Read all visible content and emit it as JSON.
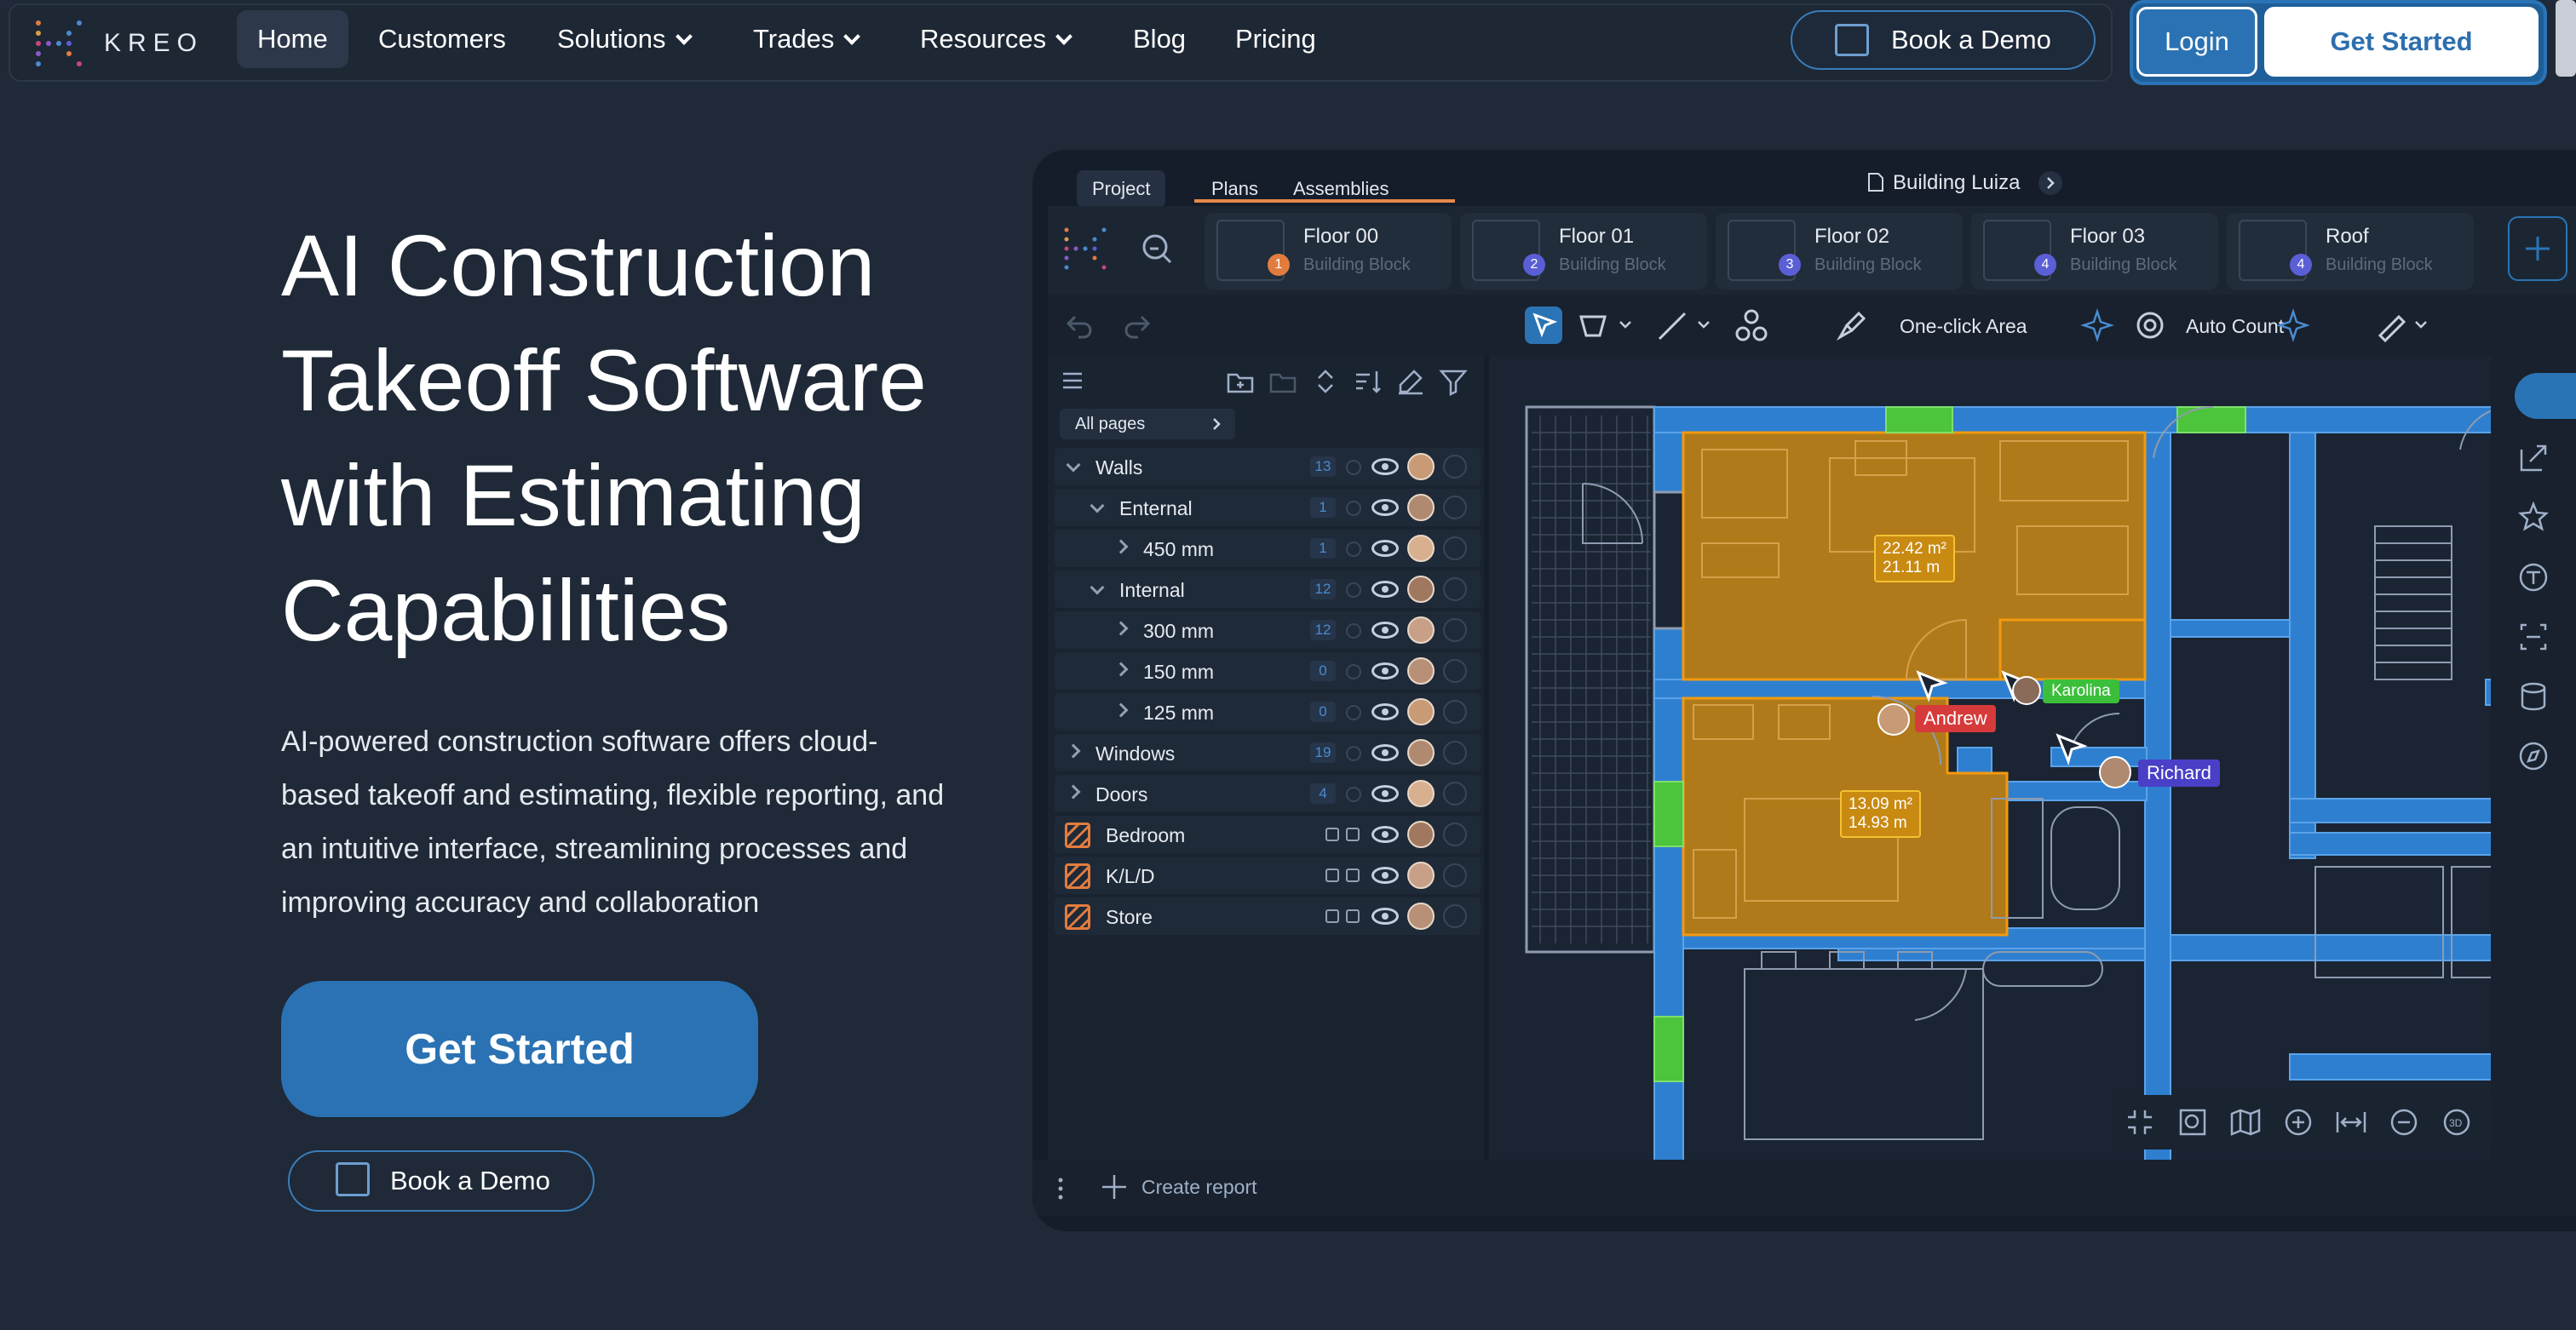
{
  "nav": {
    "brand": "KREO",
    "links": [
      {
        "label": "Home",
        "active": true
      },
      {
        "label": "Customers"
      },
      {
        "label": "Solutions",
        "dropdown": true
      },
      {
        "label": "Trades",
        "dropdown": true
      },
      {
        "label": "Resources",
        "dropdown": true
      },
      {
        "label": "Blog"
      },
      {
        "label": "Pricing"
      }
    ],
    "book_demo": "Book a Demo",
    "login": "Login",
    "get_started": "Get Started"
  },
  "hero": {
    "title_lines": [
      "AI Construction",
      "Takeoff Software",
      "with Estimating",
      "Capabilities"
    ],
    "desc_lines": [
      "AI-powered construction software offers cloud-",
      "based takeoff and estimating, flexible reporting, and",
      "an intuitive interface, streamlining processes and",
      "improving accuracy and collaboration"
    ],
    "cta": "Get Started",
    "demo": "Book a Demo"
  },
  "app": {
    "tabs": [
      "Project",
      "Plans",
      "Assemblies"
    ],
    "project_name": "Building Luiza",
    "floors": [
      {
        "name": "Floor 00",
        "sub": "Building Block",
        "badge": "1",
        "badge_color": "#e27c3e"
      },
      {
        "name": "Floor 01",
        "sub": "Building Block",
        "badge": "2",
        "badge_color": "#5a5fd6"
      },
      {
        "name": "Floor 02",
        "sub": "Building Block",
        "badge": "3",
        "badge_color": "#5a5fd6"
      },
      {
        "name": "Floor 03",
        "sub": "Building Block",
        "badge": "4",
        "badge_color": "#5a5fd6"
      },
      {
        "name": "Roof",
        "sub": "Building Block",
        "badge": "4",
        "badge_color": "#5a5fd6"
      }
    ],
    "tools": {
      "one_click": "One-click Area",
      "auto_count": "Auto Count"
    },
    "all_pages": "All pages",
    "tree": [
      {
        "label": "Walls",
        "count": "13",
        "level": 0,
        "open": true
      },
      {
        "label": "Enternal",
        "count": "1",
        "level": 1,
        "open": true
      },
      {
        "label": "450 mm",
        "count": "1",
        "level": 2,
        "open": false
      },
      {
        "label": "Internal",
        "count": "12",
        "level": 1,
        "open": true
      },
      {
        "label": "300 mm",
        "count": "12",
        "level": 2,
        "open": false
      },
      {
        "label": "150 mm",
        "count": "0",
        "level": 2,
        "open": false
      },
      {
        "label": "125 mm",
        "count": "0",
        "level": 2,
        "open": false
      },
      {
        "label": "Windows",
        "count": "19",
        "level": 0,
        "open": false
      },
      {
        "label": "Doors",
        "count": "4",
        "level": 0,
        "open": false
      },
      {
        "label": "Bedroom",
        "area": true
      },
      {
        "label": "K/L/D",
        "area": true
      },
      {
        "label": "Store",
        "area": true
      }
    ],
    "create_report": "Create report",
    "areas": [
      {
        "area": "22.42 m²",
        "perimeter": "21.11 m"
      },
      {
        "area": "13.09 m²",
        "perimeter": "14.93 m"
      }
    ],
    "collaborators": [
      {
        "name": "Andrew",
        "color": "#d63a3a"
      },
      {
        "name": "Karolina",
        "color": "#3bbf3b"
      },
      {
        "name": "Richard",
        "color": "#4a3fc7"
      }
    ]
  }
}
